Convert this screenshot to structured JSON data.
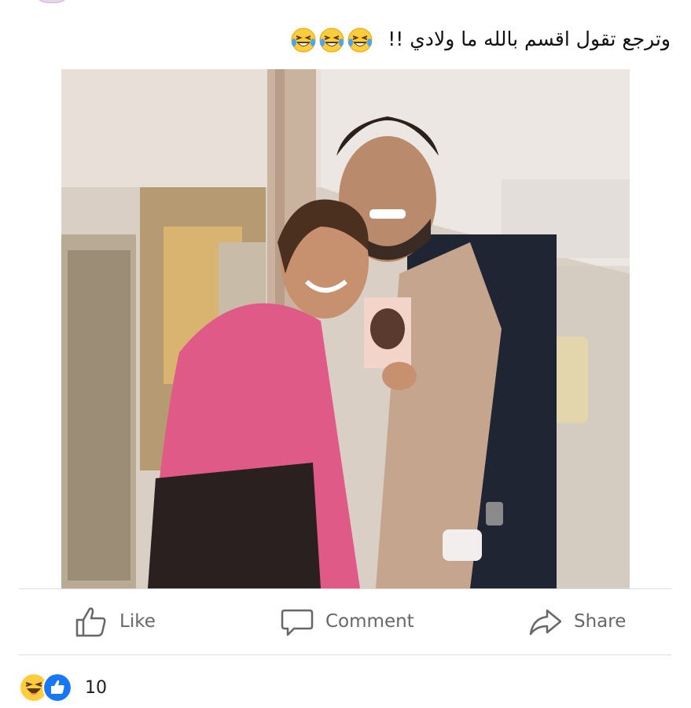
{
  "post": {
    "text": "وترجع تقول اقسم بالله ما ولادي !!",
    "emojis": [
      "laughing-tears-emoji",
      "laughing-tears-emoji",
      "laughing-tears-emoji"
    ]
  },
  "actions": {
    "like_label": "Like",
    "comment_label": "Comment",
    "share_label": "Share"
  },
  "reactions": {
    "types": [
      "haha",
      "like"
    ],
    "count": "10"
  },
  "colors": {
    "action_gray": "#65676b",
    "like_blue": "#1877f2",
    "emoji_yellow": "#ffcc3e",
    "divider": "#dadde1"
  }
}
